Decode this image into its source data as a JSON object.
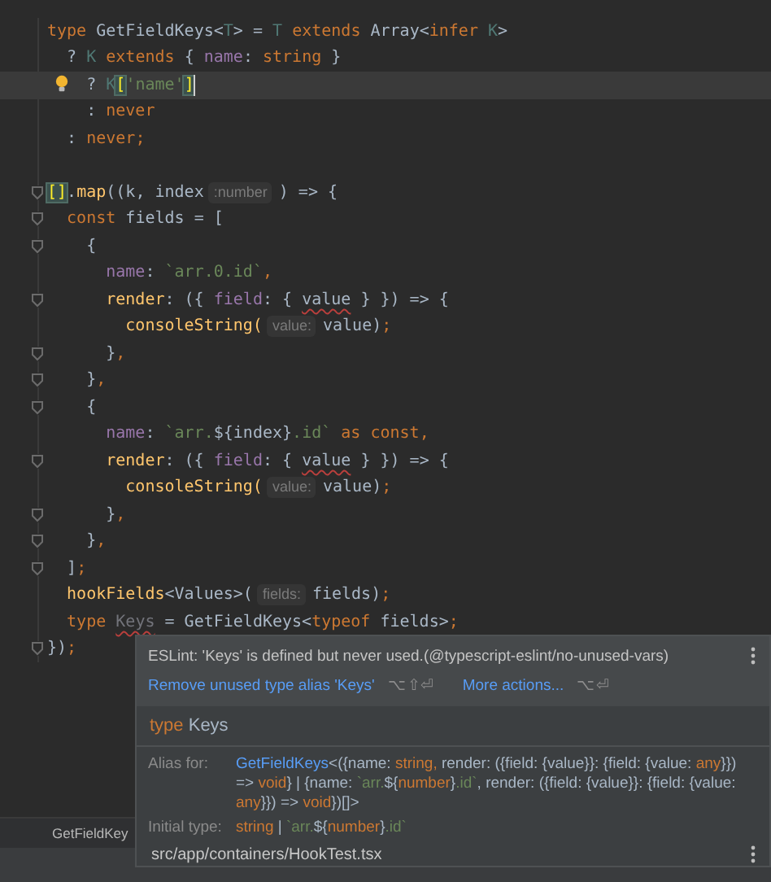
{
  "editor": {
    "lines": [
      {
        "fold": false,
        "current": false,
        "bulb": false,
        "caret": false,
        "tokens": [
          {
            "text": "type ",
            "kind": "kw"
          },
          {
            "text": "GetFieldKeys<",
            "kind": "plain"
          },
          {
            "text": "T",
            "kind": "tp"
          },
          {
            "text": "> = ",
            "kind": "plain"
          },
          {
            "text": "T",
            "kind": "tp"
          },
          {
            "text": " extends ",
            "kind": "kw"
          },
          {
            "text": "Array<",
            "kind": "plain"
          },
          {
            "text": "infer ",
            "kind": "kw"
          },
          {
            "text": "K",
            "kind": "tp"
          },
          {
            "text": ">",
            "kind": "plain"
          }
        ]
      },
      {
        "fold": false,
        "current": false,
        "bulb": false,
        "caret": false,
        "tokens": [
          {
            "text": "  ? ",
            "kind": "plain"
          },
          {
            "text": "K",
            "kind": "tp"
          },
          {
            "text": " extends ",
            "kind": "kw"
          },
          {
            "text": "{ ",
            "kind": "plain"
          },
          {
            "text": "name",
            "kind": "prop"
          },
          {
            "text": ": ",
            "kind": "plain"
          },
          {
            "text": "string",
            "kind": "kw"
          },
          {
            "text": " }",
            "kind": "plain"
          }
        ]
      },
      {
        "fold": false,
        "current": true,
        "bulb": true,
        "caret": true,
        "tokens": [
          {
            "text": "    ? ",
            "kind": "plain"
          },
          {
            "text": "K",
            "kind": "tp"
          },
          {
            "text": "[",
            "kind": "match"
          },
          {
            "text": "'name'",
            "kind": "str"
          },
          {
            "text": "]",
            "kind": "match"
          }
        ]
      },
      {
        "fold": false,
        "current": false,
        "bulb": false,
        "caret": false,
        "tokens": [
          {
            "text": "    : ",
            "kind": "plain"
          },
          {
            "text": "never",
            "kind": "kw"
          }
        ]
      },
      {
        "fold": false,
        "current": false,
        "bulb": false,
        "caret": false,
        "tokens": [
          {
            "text": "  : ",
            "kind": "plain"
          },
          {
            "text": "never;",
            "kind": "kw"
          }
        ]
      },
      {
        "fold": false,
        "current": false,
        "bulb": false,
        "caret": false
      },
      {
        "fold": true,
        "current": false,
        "bulb": false,
        "caret": false,
        "tokens": [
          {
            "text": "[]",
            "kind": "match"
          },
          {
            "text": ".",
            "kind": "plain"
          },
          {
            "text": "map",
            "kind": "fn"
          },
          {
            "text": "((k, index",
            "kind": "plain"
          },
          {
            "text": ":number",
            "kind": "hint"
          },
          {
            "text": ") => {",
            "kind": "plain"
          }
        ]
      },
      {
        "fold": true,
        "current": false,
        "bulb": false,
        "caret": false,
        "tokens": [
          {
            "text": "  const",
            "kind": "kw"
          },
          {
            "text": " fields = [",
            "kind": "plain"
          }
        ]
      },
      {
        "fold": true,
        "current": false,
        "bulb": false,
        "caret": false,
        "tokens": [
          {
            "text": "    {",
            "kind": "plain"
          }
        ]
      },
      {
        "fold": false,
        "current": false,
        "bulb": false,
        "caret": false,
        "tokens": [
          {
            "text": "      name",
            "kind": "prop"
          },
          {
            "text": ": ",
            "kind": "plain"
          },
          {
            "text": "`arr.0.id`",
            "kind": "str"
          },
          {
            "text": ",",
            "kind": "kw"
          }
        ]
      },
      {
        "fold": true,
        "current": false,
        "bulb": false,
        "caret": false,
        "tokens": [
          {
            "text": "      render",
            "kind": "fn"
          },
          {
            "text": ": ({ ",
            "kind": "plain"
          },
          {
            "text": "field",
            "kind": "prop"
          },
          {
            "text": ": { ",
            "kind": "plain"
          },
          {
            "text": "value",
            "kind": "err"
          },
          {
            "text": " } }) => {",
            "kind": "plain"
          }
        ]
      },
      {
        "fold": false,
        "current": false,
        "bulb": false,
        "caret": false,
        "tokens": [
          {
            "text": "        consoleString(",
            "kind": "fn"
          },
          {
            "text": "value:",
            "kind": "hint"
          },
          {
            "text": "value)",
            "kind": "plain"
          },
          {
            "text": ";",
            "kind": "kw"
          }
        ]
      },
      {
        "fold": true,
        "current": false,
        "bulb": false,
        "caret": false,
        "tokens": [
          {
            "text": "      }",
            "kind": "plain"
          },
          {
            "text": ",",
            "kind": "kw"
          }
        ]
      },
      {
        "fold": true,
        "current": false,
        "bulb": false,
        "caret": false,
        "tokens": [
          {
            "text": "    }",
            "kind": "plain"
          },
          {
            "text": ",",
            "kind": "kw"
          }
        ]
      },
      {
        "fold": true,
        "current": false,
        "bulb": false,
        "caret": false,
        "tokens": [
          {
            "text": "    {",
            "kind": "plain"
          }
        ]
      },
      {
        "fold": false,
        "current": false,
        "bulb": false,
        "caret": false,
        "tokens": [
          {
            "text": "      name",
            "kind": "prop"
          },
          {
            "text": ": ",
            "kind": "plain"
          },
          {
            "text": "`arr.",
            "kind": "str"
          },
          {
            "text": "${index}",
            "kind": "plain"
          },
          {
            "text": ".id`",
            "kind": "str"
          },
          {
            "text": " as const",
            "kind": "kw"
          },
          {
            "text": ",",
            "kind": "kw"
          }
        ]
      },
      {
        "fold": true,
        "current": false,
        "bulb": false,
        "caret": false,
        "tokens": [
          {
            "text": "      render",
            "kind": "fn"
          },
          {
            "text": ": ({ ",
            "kind": "plain"
          },
          {
            "text": "field",
            "kind": "prop"
          },
          {
            "text": ": { ",
            "kind": "plain"
          },
          {
            "text": "value",
            "kind": "err"
          },
          {
            "text": " } }) => {",
            "kind": "plain"
          }
        ]
      },
      {
        "fold": false,
        "current": false,
        "bulb": false,
        "caret": false,
        "tokens": [
          {
            "text": "        consoleString(",
            "kind": "fn"
          },
          {
            "text": "value:",
            "kind": "hint"
          },
          {
            "text": "value)",
            "kind": "plain"
          },
          {
            "text": ";",
            "kind": "kw"
          }
        ]
      },
      {
        "fold": true,
        "current": false,
        "bulb": false,
        "caret": false,
        "tokens": [
          {
            "text": "      }",
            "kind": "plain"
          },
          {
            "text": ",",
            "kind": "kw"
          }
        ]
      },
      {
        "fold": true,
        "current": false,
        "bulb": false,
        "caret": false,
        "tokens": [
          {
            "text": "    }",
            "kind": "plain"
          },
          {
            "text": ",",
            "kind": "kw"
          }
        ]
      },
      {
        "fold": true,
        "current": false,
        "bulb": false,
        "caret": false,
        "tokens": [
          {
            "text": "  ]",
            "kind": "plain"
          },
          {
            "text": ";",
            "kind": "kw"
          }
        ]
      },
      {
        "fold": false,
        "current": false,
        "bulb": false,
        "caret": false,
        "tokens": [
          {
            "text": "  hookFields",
            "kind": "fn"
          },
          {
            "text": "<Values>(",
            "kind": "plain"
          },
          {
            "text": "fields:",
            "kind": "hint"
          },
          {
            "text": "fields)",
            "kind": "plain"
          },
          {
            "text": ";",
            "kind": "kw"
          }
        ]
      },
      {
        "fold": false,
        "current": false,
        "bulb": false,
        "caret": false,
        "tokens": [
          {
            "text": "  type ",
            "kind": "kw"
          },
          {
            "text": "Keys",
            "kind": "unused"
          },
          {
            "text": " = GetFieldKeys<",
            "kind": "plain"
          },
          {
            "text": "typeof",
            "kind": "kw"
          },
          {
            "text": " fields>",
            "kind": "plain"
          },
          {
            "text": ";",
            "kind": "kw"
          }
        ]
      },
      {
        "fold": true,
        "current": false,
        "bulb": false,
        "caret": false,
        "tokens": [
          {
            "text": "})",
            "kind": "plain"
          },
          {
            "text": ";",
            "kind": "kw"
          }
        ]
      }
    ]
  },
  "breadcrumb": {
    "items": [
      {
        "label": "GetFieldKey"
      }
    ]
  },
  "popup": {
    "message": "ESLint: 'Keys' is defined but never used.(@typescript-eslint/no-unused-vars)",
    "actions": [
      {
        "label": "Remove unused type alias 'Keys'",
        "shortcut": "⌥⇧⏎"
      },
      {
        "label": "More actions...",
        "shortcut": "⌥⏎"
      }
    ],
    "declaration": [
      {
        "text": "type",
        "kind": "kw"
      },
      {
        "text": " Keys",
        "kind": "plain"
      }
    ],
    "details": [
      {
        "label": "Alias for:",
        "tokens": [
          {
            "text": "GetFieldKeys",
            "kind": "link"
          },
          {
            "text": "<({name: ",
            "kind": "plain"
          },
          {
            "text": "string,",
            "kind": "kw"
          },
          {
            "text": " render: ({field: {value}}: {field: {value: ",
            "kind": "plain"
          },
          {
            "text": "any",
            "kind": "kw"
          },
          {
            "text": "}}) => ",
            "kind": "plain"
          },
          {
            "text": "void",
            "kind": "kw"
          },
          {
            "text": "} | {name: ",
            "kind": "plain"
          },
          {
            "text": "`arr.",
            "kind": "str"
          },
          {
            "text": "${",
            "kind": "plain"
          },
          {
            "text": "number",
            "kind": "kw"
          },
          {
            "text": "}",
            "kind": "plain"
          },
          {
            "text": ".id`",
            "kind": "str"
          },
          {
            "text": ", render: ({field: {value}}: {field: {value: ",
            "kind": "plain"
          },
          {
            "text": "any",
            "kind": "kw"
          },
          {
            "text": "}}) => ",
            "kind": "plain"
          },
          {
            "text": "void",
            "kind": "kw"
          },
          {
            "text": "})[]>",
            "kind": "plain"
          }
        ]
      },
      {
        "label": "Initial type:",
        "tokens": [
          {
            "text": "string",
            "kind": "kw"
          },
          {
            "text": " | ",
            "kind": "plain"
          },
          {
            "text": "`arr.",
            "kind": "str"
          },
          {
            "text": "${",
            "kind": "plain"
          },
          {
            "text": "number",
            "kind": "kw"
          },
          {
            "text": "}",
            "kind": "plain"
          },
          {
            "text": ".id`",
            "kind": "str"
          }
        ]
      }
    ],
    "file": "src/app/containers/HookTest.tsx"
  }
}
